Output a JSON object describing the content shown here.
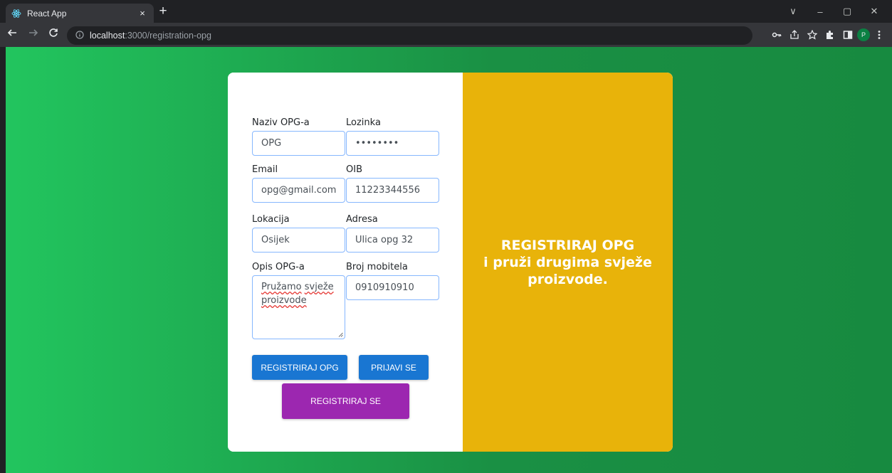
{
  "browser": {
    "tab_title": "React App",
    "tab_close": "×",
    "new_tab": "+",
    "url_host": "localhost",
    "url_rest": ":3000/registration-opg",
    "profile_initial": "P",
    "window_controls": {
      "minimize_down": "∨",
      "minimize": "–",
      "restore": "▢",
      "close": "✕"
    },
    "icons": [
      "back-icon",
      "forward-icon",
      "reload-icon",
      "info-icon",
      "key-icon",
      "share-icon",
      "star-icon",
      "extensions-icon",
      "side-panel-icon",
      "profile-avatar",
      "menu-icon"
    ]
  },
  "form": {
    "fields": {
      "naziv": {
        "label": "Naziv OPG-a",
        "value": "OPG"
      },
      "lozinka": {
        "label": "Lozinka",
        "value": "••••••••"
      },
      "email": {
        "label": "Email",
        "value": "opg@gmail.com"
      },
      "oib": {
        "label": "OIB",
        "value": "11223344556"
      },
      "lokacija": {
        "label": "Lokacija",
        "value": "Osijek"
      },
      "adresa": {
        "label": "Adresa",
        "value": "Ulica opg 32"
      },
      "opis": {
        "label": "Opis OPG-a",
        "value_word1": "Pružamo",
        "value_word2": "svježe",
        "value_word3": "proizvode"
      },
      "mobitel": {
        "label": "Broj mobitela",
        "value": "0910910910"
      }
    },
    "buttons": {
      "register_opg": "REGISTRIRAJ OPG",
      "login": "PRIJAVI SE",
      "register": "REGISTRIRAJ SE"
    }
  },
  "promo": {
    "title": "REGISTRIRAJ OPG",
    "subtitle": "i pruži drugima svježe proizvode."
  },
  "colors": {
    "background_gradient": [
      "#22c55e",
      "#178a40"
    ],
    "promo_panel": "#e8b30a",
    "primary_button": "#1976d2",
    "secondary_button": "#9c27b0",
    "input_border": "#86b7fe"
  }
}
